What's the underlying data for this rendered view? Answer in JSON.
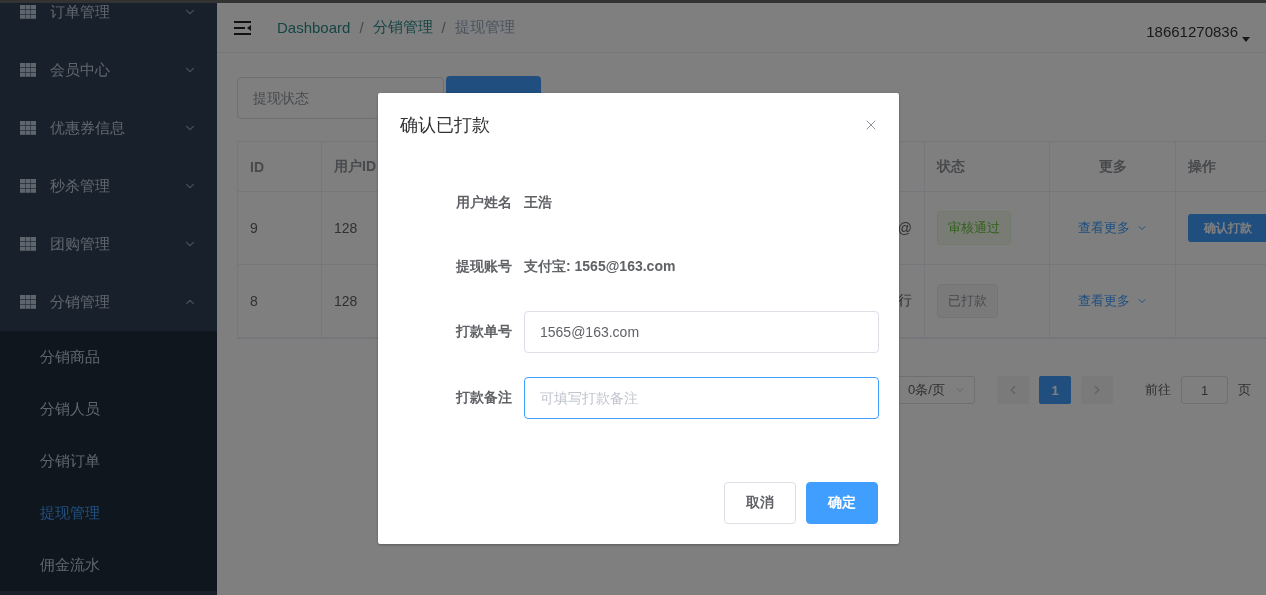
{
  "sidebar": {
    "items": [
      {
        "label": "订单管理",
        "expanded": false
      },
      {
        "label": "会员中心",
        "expanded": false
      },
      {
        "label": "优惠券信息",
        "expanded": false
      },
      {
        "label": "秒杀管理",
        "expanded": false
      },
      {
        "label": "团购管理",
        "expanded": false
      },
      {
        "label": "分销管理",
        "expanded": true,
        "children": [
          {
            "label": "分销商品",
            "selected": false
          },
          {
            "label": "分销人员",
            "selected": false
          },
          {
            "label": "分销订单",
            "selected": false
          },
          {
            "label": "提现管理",
            "selected": true
          },
          {
            "label": "佣金流水",
            "selected": false
          }
        ]
      }
    ]
  },
  "header": {
    "breadcrumb": [
      {
        "label": "Dashboard",
        "link": true
      },
      {
        "label": "分销管理",
        "link": true
      },
      {
        "label": "提现管理",
        "link": false
      }
    ],
    "separator": "/",
    "user": "18661270836"
  },
  "filter": {
    "placeholder": "提现状态"
  },
  "table": {
    "columns": [
      "ID",
      "用户ID",
      "",
      "状态",
      "更多",
      "操作"
    ],
    "rows": [
      {
        "id": "9",
        "user_id": "128",
        "column_3": "@",
        "status": {
          "label": "审核通过",
          "kind": "success"
        },
        "more": "查看更多",
        "action": "确认打款"
      },
      {
        "id": "8",
        "user_id": "128",
        "column_3": "行",
        "status": {
          "label": "已打款",
          "kind": "info"
        },
        "more": "查看更多"
      }
    ]
  },
  "pagination": {
    "page_size": "0条/页",
    "pages": [
      {
        "label": "1",
        "selected": true
      }
    ],
    "goto_label": "前往",
    "goto_value": "1",
    "page_label": "页"
  },
  "dialog": {
    "title": "确认已打款",
    "fields": [
      {
        "kind": "text",
        "label": "用户姓名",
        "value": "王浩"
      },
      {
        "kind": "text",
        "label": "提现账号",
        "value": "支付宝: 1565@163.com"
      },
      {
        "kind": "input",
        "label": "打款单号",
        "value": "1565@163.com",
        "focused": false
      },
      {
        "kind": "input",
        "label": "打款备注",
        "placeholder": "可填写打款备注",
        "focused": true
      }
    ],
    "buttons": [
      {
        "label": "取消",
        "primary": false
      },
      {
        "label": "确定",
        "primary": true
      }
    ]
  }
}
